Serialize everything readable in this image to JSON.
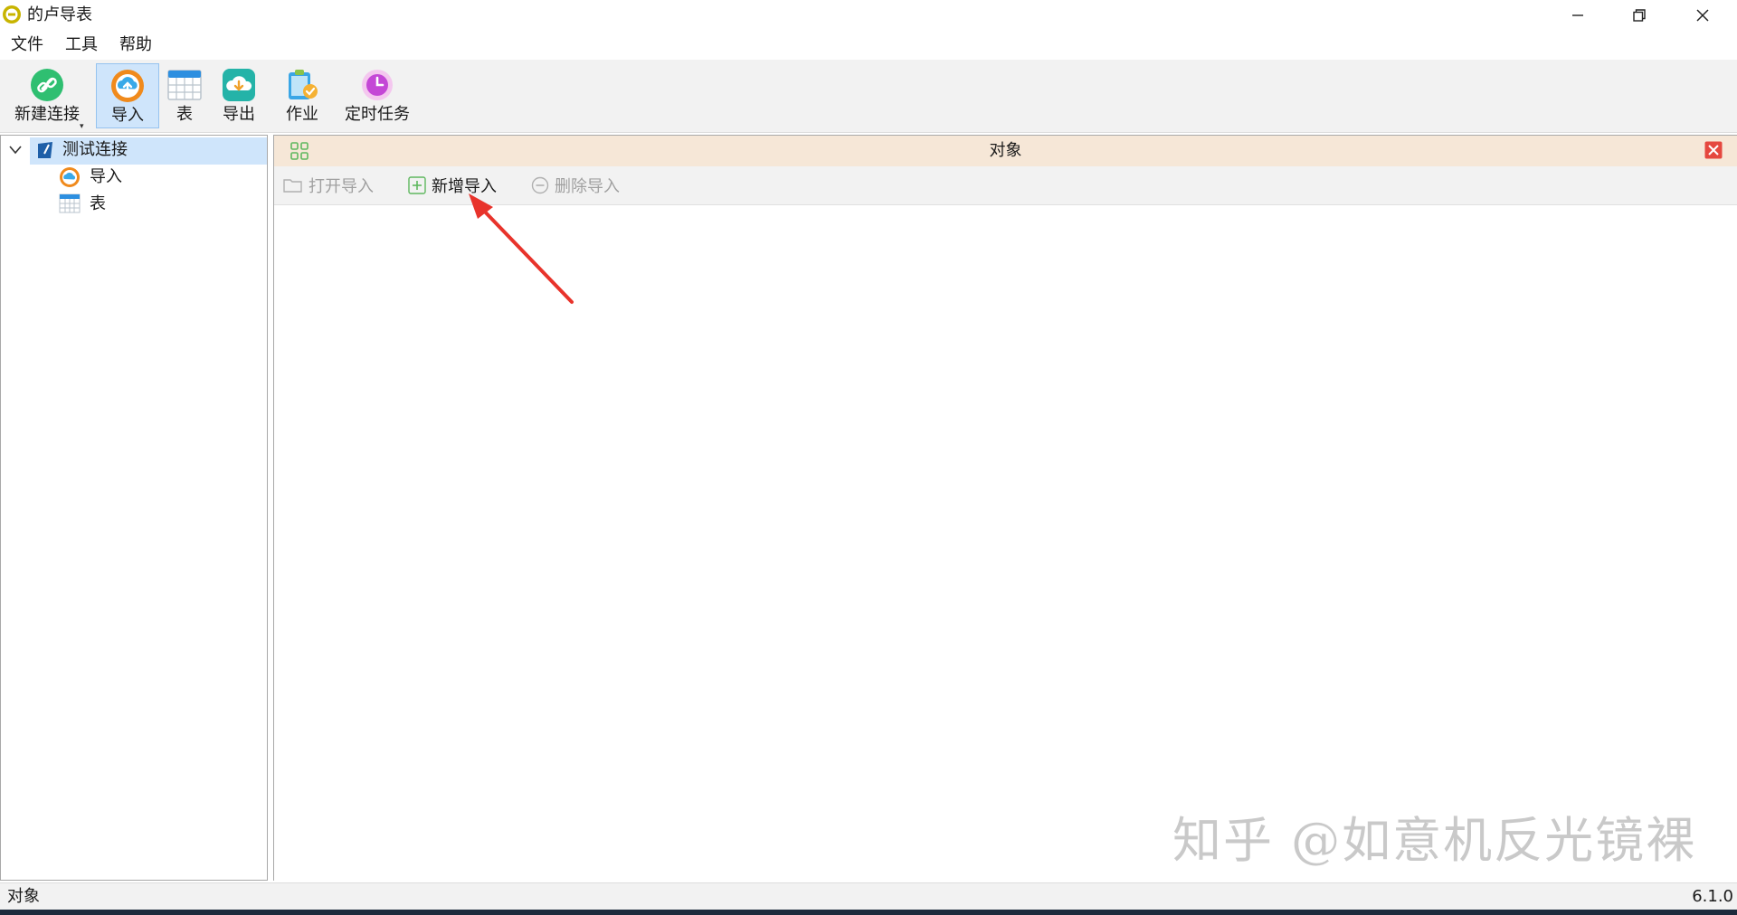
{
  "window": {
    "title": "的卢导表"
  },
  "menu": [
    "文件",
    "工具",
    "帮助"
  ],
  "toolbar": {
    "new_connection": "新建连接",
    "import": "导入",
    "table": "表",
    "export": "导出",
    "job": "作业",
    "scheduled_task": "定时任务",
    "active": "导入"
  },
  "tree": {
    "root": "测试连接",
    "children": [
      "导入",
      "表"
    ]
  },
  "panel": {
    "title": "对象",
    "actions": {
      "open_import": "打开导入",
      "new_import": "新增导入",
      "delete_import": "删除导入"
    }
  },
  "status": {
    "left": "对象",
    "version": "6.1.0"
  },
  "watermark": "知乎 @如意机反光镜裸",
  "colors": {
    "accent_selected": "#cfe5fb",
    "panel_header": "#f6e7d7",
    "annotation_arrow": "#e8332b",
    "close_red": "#e5483f"
  }
}
